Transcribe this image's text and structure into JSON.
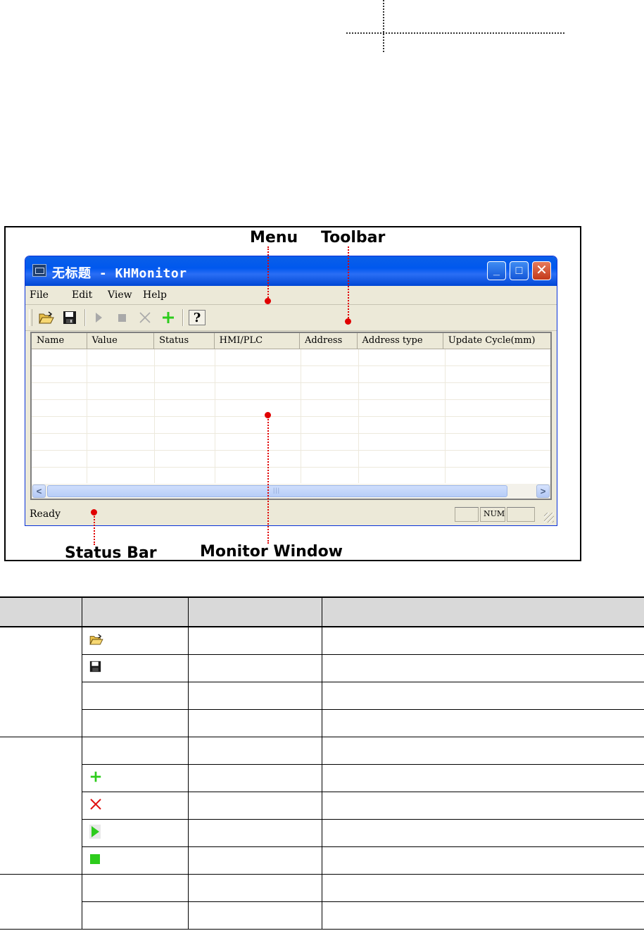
{
  "figure": {
    "callouts": {
      "menu": "Menu",
      "toolbar": "Toolbar",
      "status_bar": "Status Bar",
      "monitor_window": "Monitor Window"
    }
  },
  "window": {
    "title": "无标题 - KHMonitor",
    "controls": {
      "minimize": "_",
      "maximize": "□",
      "close": "✕"
    },
    "menu": [
      "File",
      "Edit",
      "View",
      "Help"
    ],
    "toolbar_icons": [
      "open-folder-icon",
      "save-disk-icon",
      "play-icon",
      "stop-icon",
      "delete-x-icon",
      "add-plus-icon",
      "help-question-icon"
    ],
    "columns": [
      "Name",
      "Value",
      "Status",
      "HMI/PLC",
      "Address",
      "Address type",
      "Update Cycle(mm)"
    ],
    "status": {
      "text": "Ready",
      "num": "NUM"
    },
    "colors": {
      "title_bar": "#0058ee",
      "chrome": "#ece9d8",
      "close_button": "#c4391a",
      "add_icon": "#2dcc1c",
      "delete_icon": "#e01010"
    }
  },
  "table": {
    "header": [
      "",
      "",
      "",
      ""
    ],
    "icons": [
      "open-folder-icon",
      "save-disk-icon",
      "",
      "",
      "",
      "add-plus-icon",
      "delete-x-icon",
      "play-icon",
      "stop-icon",
      "",
      ""
    ]
  }
}
